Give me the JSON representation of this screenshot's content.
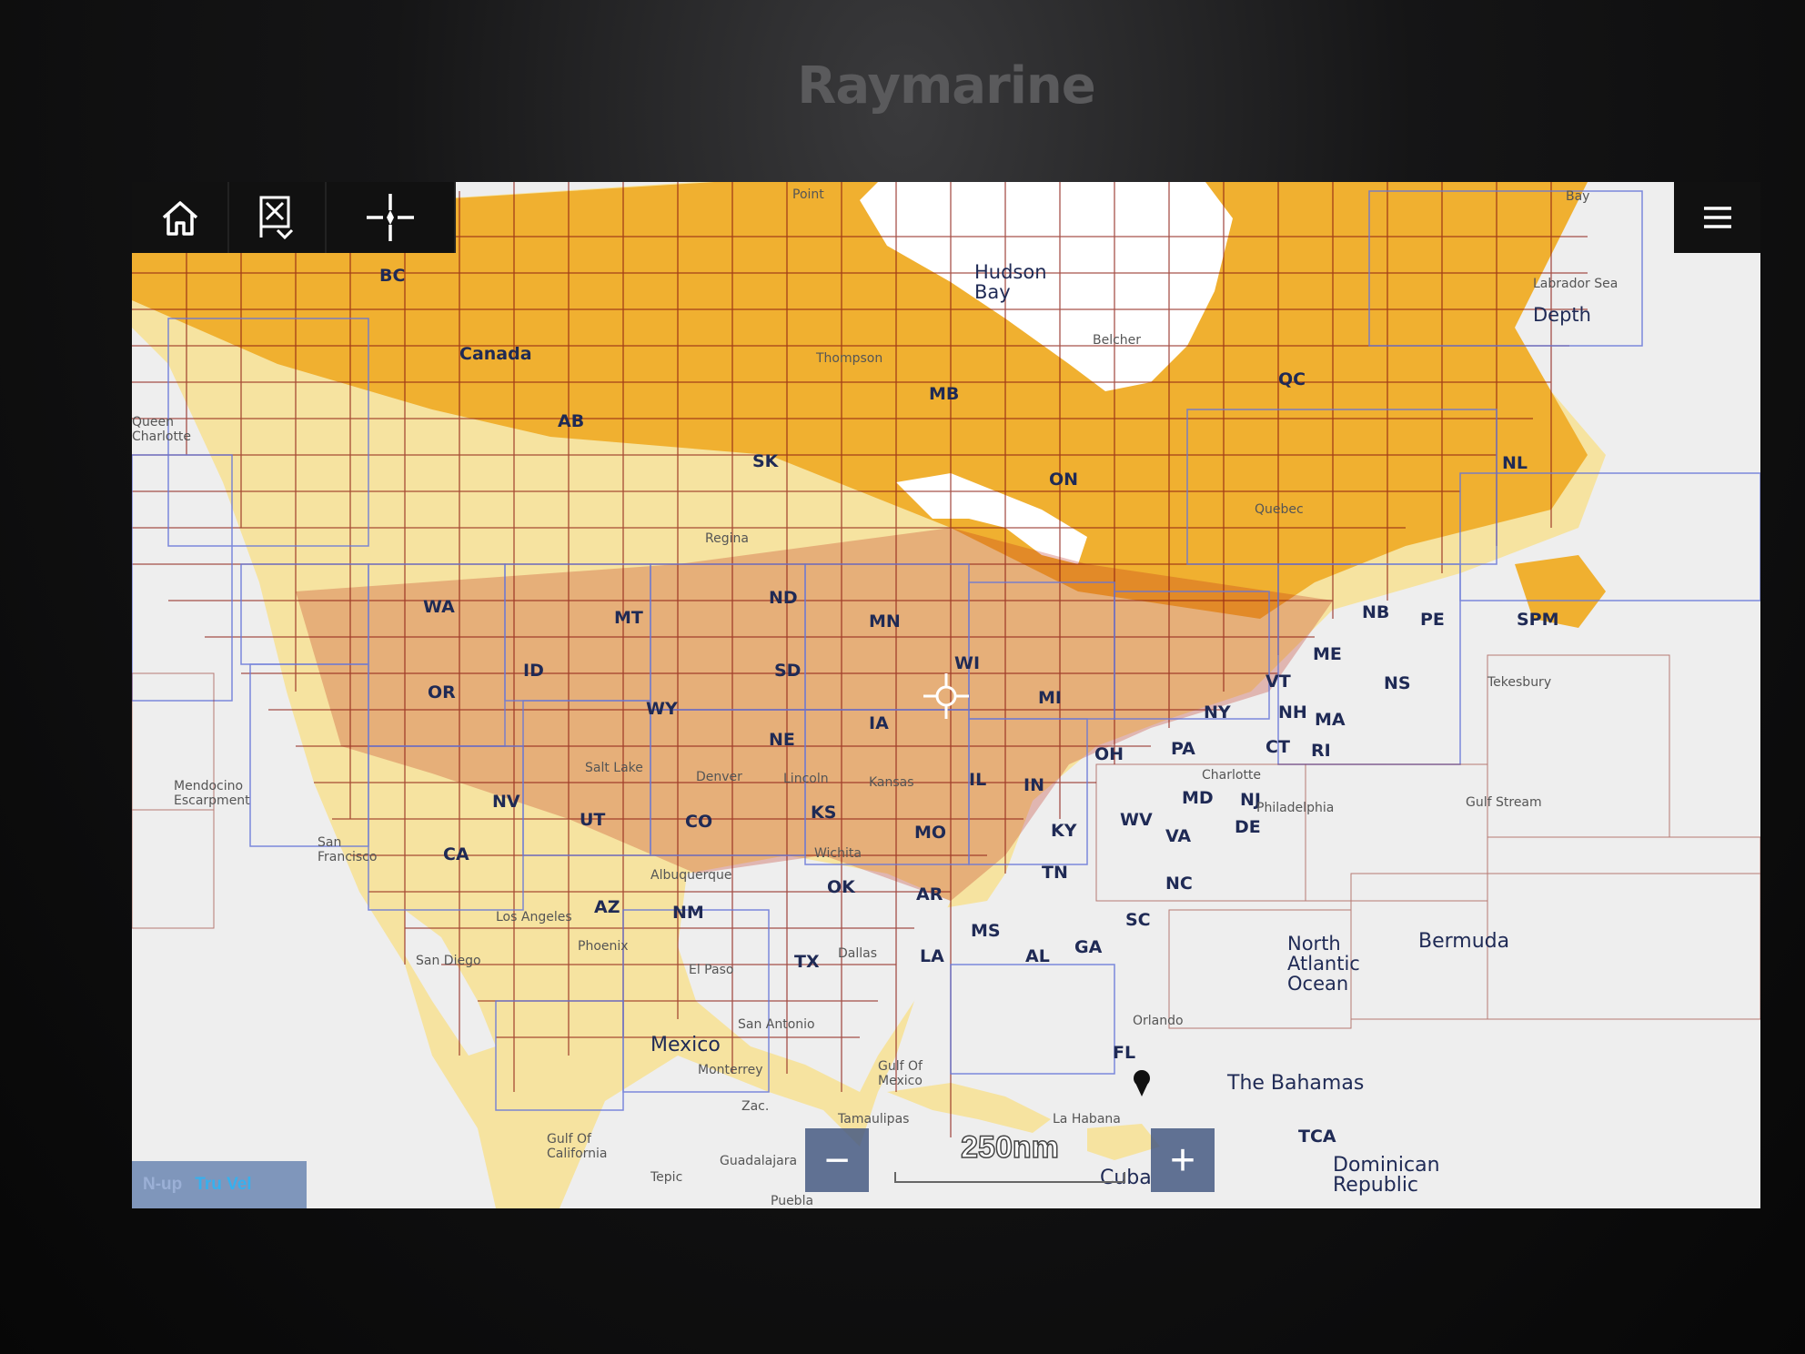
{
  "device": {
    "brand": "Raymarine"
  },
  "map": {
    "colors": {
      "sea": "#eeeeee",
      "land": "#f6e3a0",
      "coverage": "#f0b030",
      "coverage_dark": "#e49a1f",
      "tile_line": "#8a1a10",
      "blue_line": "#6676d8",
      "lake": "#ffffff"
    },
    "states": [
      "BC",
      "Canada",
      "AB",
      "SK",
      "MB",
      "ON",
      "QC",
      "NL",
      "NB",
      "PE",
      "NS",
      "SPM",
      "WA",
      "OR",
      "ID",
      "MT",
      "WY",
      "ND",
      "SD",
      "NE",
      "MN",
      "WI",
      "MI",
      "IA",
      "IL",
      "IN",
      "OH",
      "PA",
      "NY",
      "VT",
      "NH",
      "ME",
      "MA",
      "CT",
      "RI",
      "NJ",
      "DE",
      "MD",
      "VA",
      "WV",
      "KY",
      "TN",
      "NC",
      "SC",
      "GA",
      "AL",
      "MS",
      "LA",
      "AR",
      "MO",
      "KS",
      "OK",
      "TX",
      "NM",
      "AZ",
      "CO",
      "UT",
      "NV",
      "CA",
      "FL",
      "TCA"
    ],
    "places": [
      "Hudson Bay",
      "Belcher",
      "Thompson",
      "Regina",
      "Queen Charlotte",
      "Mendocino Escarpment",
      "San Francisco",
      "Salt Lake",
      "Denver",
      "Lincoln",
      "Kansas",
      "Wichita",
      "Albuquerque",
      "Phoenix",
      "El Paso",
      "San Antonio",
      "Dallas",
      "Monterrey",
      "Gulf Of Mexico",
      "Gulf Of California",
      "Tepic",
      "Guadalajara",
      "Puebla",
      "Tamaulipas",
      "La Habana",
      "Orlando",
      "Quebec",
      "San Diego",
      "Los Angeles",
      "Charlotte",
      "Gulf Stream",
      "Depth",
      "Bay",
      "Labrador Sea",
      "Point",
      "Zac.",
      "Tekesbury",
      "Philadelphia"
    ],
    "oceans": [
      "North Atlantic Ocean",
      "Mexico",
      "Cuba",
      "The Bahamas",
      "Bermuda",
      "Dominican Republic"
    ]
  },
  "controls": {
    "home_icon": "home-icon",
    "waypoint_icon": "waypoint-icon",
    "crosshair_icon": "crosshair-icon",
    "menu_icon": "menu-icon",
    "orientation_mode": "N-up",
    "motion_mode": "Tru Vel",
    "zoom_out": "−",
    "zoom_in": "+",
    "scale": "250nm"
  }
}
